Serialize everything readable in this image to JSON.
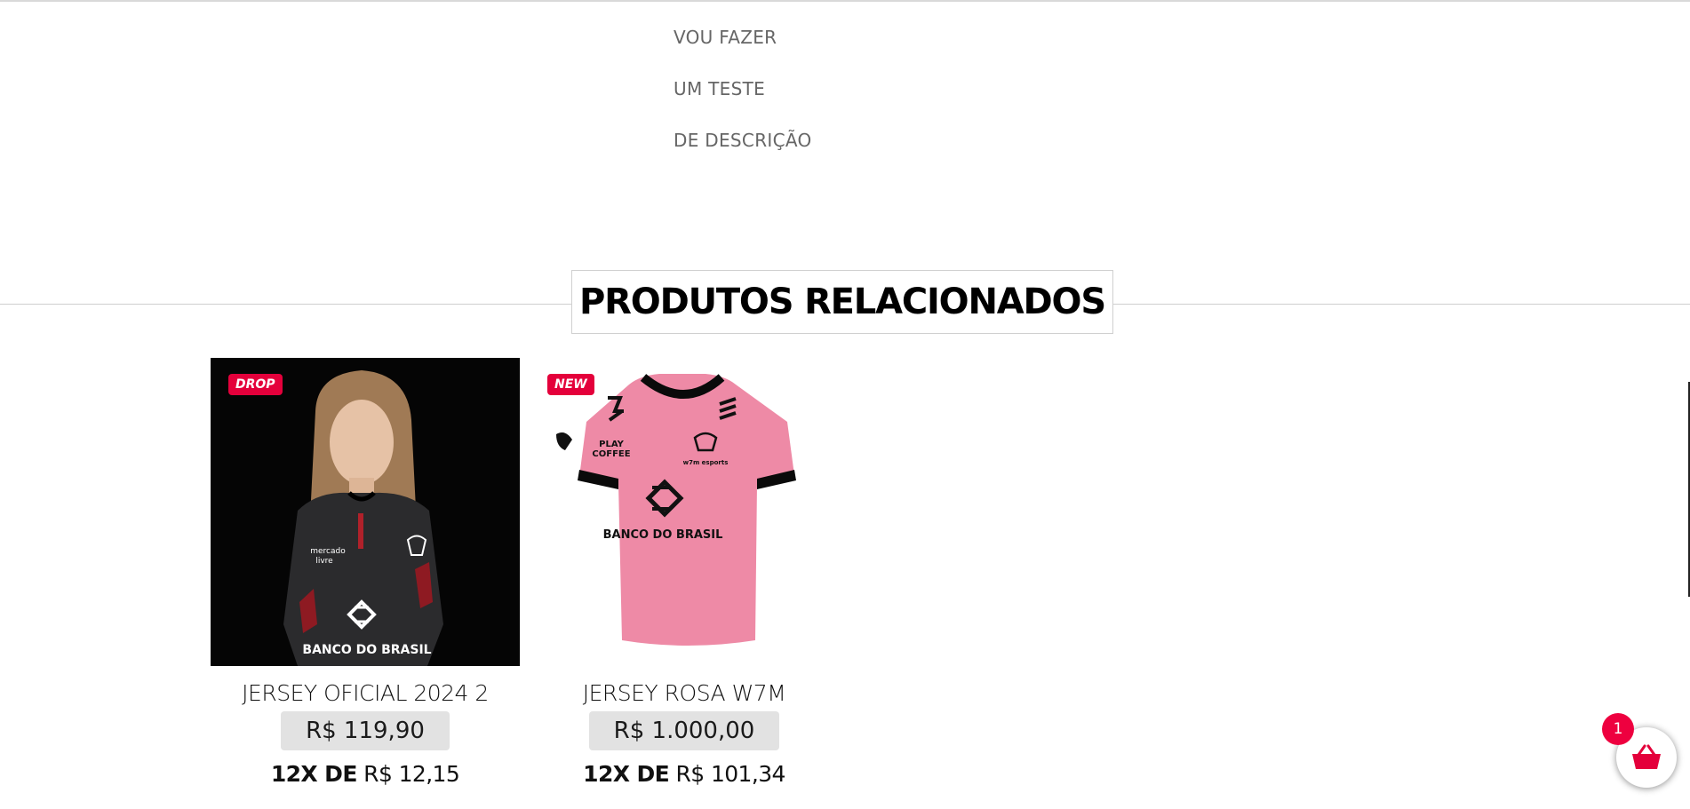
{
  "description": {
    "lines": [
      "VOU FAZER",
      "UM TESTE",
      "DE DESCRIÇÃO"
    ]
  },
  "related": {
    "title": "PRODUTOS RELACIONADOS",
    "products": [
      {
        "badge": "DROP",
        "name": "JERSEY OFICIAL 2024 2",
        "price": "R$ 119,90",
        "installment_prefix": "12X DE",
        "installment_value": "R$ 12,15",
        "image": "model-wearing-black-jersey-photo",
        "image_text": [
          "mercado",
          "livre",
          "BANCO DO BRASIL"
        ]
      },
      {
        "badge": "NEW",
        "name": "JERSEY ROSA W7M",
        "price": "R$ 1.000,00",
        "installment_prefix": "12X DE",
        "installment_value": "R$ 101,34",
        "image": "pink-jersey-photo",
        "image_text": [
          "PLAY",
          "COFFEE",
          "w7m esports",
          "BANCO DO BRASIL"
        ]
      }
    ]
  },
  "cart": {
    "count": "1",
    "icon": "basket-icon"
  },
  "colors": {
    "badge": "#e4003b",
    "price_bg": "#e2e2e2",
    "jersey_pink": "#ee8aa6",
    "cart_badge": "#ee003f"
  }
}
